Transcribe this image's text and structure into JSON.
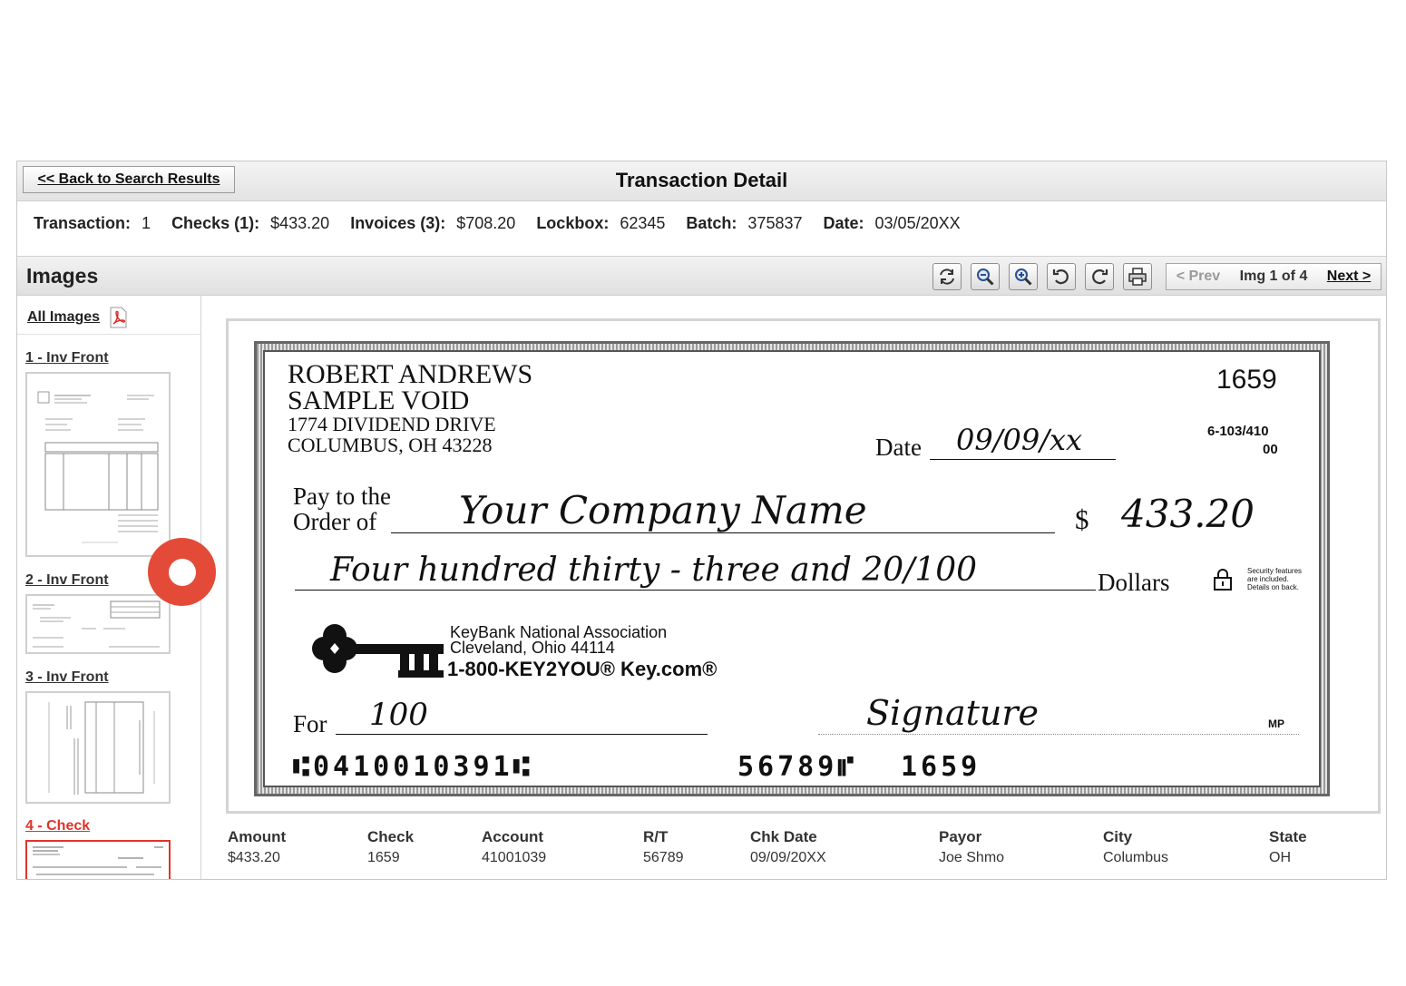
{
  "header": {
    "back_label": "<< Back to Search Results",
    "title": "Transaction Detail"
  },
  "summary": {
    "transaction_label": "Transaction:",
    "transaction_value": "1",
    "checks_label": "Checks (1):",
    "checks_value": "$433.20",
    "invoices_label": "Invoices (3):",
    "invoices_value": "$708.20",
    "lockbox_label": "Lockbox:",
    "lockbox_value": "62345",
    "batch_label": "Batch:",
    "batch_value": "375837",
    "date_label": "Date:",
    "date_value": "03/05/20XX"
  },
  "images_bar": {
    "title": "Images",
    "toolbar_icons": [
      "refresh-icon",
      "zoom-out-icon",
      "zoom-in-icon",
      "rotate-left-icon",
      "rotate-right-icon",
      "print-icon"
    ],
    "prev_label": "< Prev",
    "img_count": "Img 1 of 4",
    "next_label": "Next >"
  },
  "sidebar": {
    "all_images_label": "All Images",
    "thumbs": [
      {
        "label": "1 - Inv Front"
      },
      {
        "label": "2 - Inv Front"
      },
      {
        "label": "3 - Inv Front"
      },
      {
        "label": "4 - Check",
        "active": true
      }
    ]
  },
  "check": {
    "name_line1": "ROBERT ANDREWS",
    "name_line2": "SAMPLE VOID",
    "address_line1": "1774 DIVIDEND DRIVE",
    "address_line2": "COLUMBUS, OH  43228",
    "check_number": "1659",
    "routing_fraction_top": "6-103/410",
    "routing_fraction_bottom": "00",
    "date_label": "Date",
    "date_value": "09/09/xx",
    "pay_to_line1": "Pay to the",
    "pay_to_line2": "Order of",
    "payee": "Your Company Name",
    "dollar_sign": "$",
    "amount": "433.20",
    "amount_words": "Four hundred thirty - three and 20/100",
    "dollars_label": "Dollars",
    "security_note": "Security features are included. Details on back.",
    "bank_name": "KeyBank National Association",
    "bank_city": "Cleveland, Ohio 44114",
    "bank_phone": "1-800-KEY2YOU® Key.com®",
    "for_label": "For",
    "memo": "100",
    "signature": "Signature",
    "mp_mark": "MP",
    "micr_routing": "⑆0410010391⑆",
    "micr_account": "56789⑈",
    "micr_check": "1659"
  },
  "details": {
    "columns": [
      {
        "header": "Amount",
        "value": "$433.20"
      },
      {
        "header": "Check",
        "value": "1659"
      },
      {
        "header": "Account",
        "value": "41001039"
      },
      {
        "header": "R/T",
        "value": "56789"
      },
      {
        "header": "Chk Date",
        "value": "09/09/20XX"
      },
      {
        "header": "Payor",
        "value": "Joe Shmo"
      },
      {
        "header": "City",
        "value": "Columbus"
      },
      {
        "header": "State",
        "value": "OH"
      }
    ]
  },
  "colors": {
    "marker": "#e34b38",
    "active_thumb_label": "#e0342b"
  }
}
